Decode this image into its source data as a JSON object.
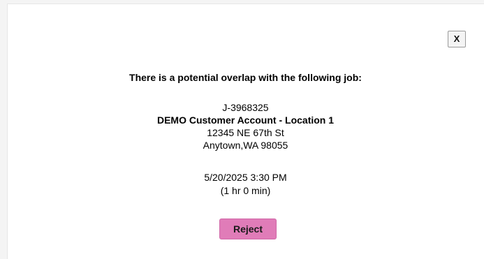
{
  "dialog": {
    "close_label": "X",
    "heading": "There is a potential overlap with the following job:",
    "job": {
      "id": "J-3968325",
      "account": "DEMO Customer Account - Location 1",
      "address_line1": "12345 NE 67th St",
      "address_line2": "Anytown,WA 98055"
    },
    "schedule": {
      "datetime": "5/20/2025 3:30 PM",
      "duration": "(1 hr 0 min)"
    },
    "reject_label": "Reject",
    "colors": {
      "reject_button": "#e07cb8",
      "background": "#ffffff"
    }
  }
}
